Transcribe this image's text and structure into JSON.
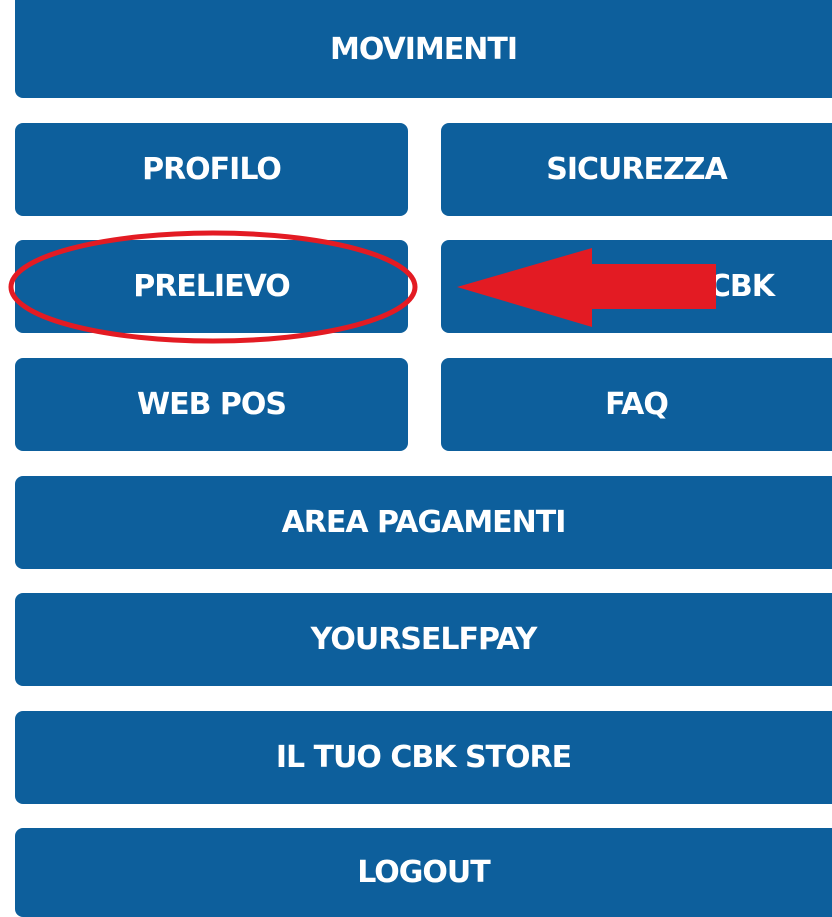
{
  "menu": {
    "movimenti_label": "MOVIMENTI",
    "profilo_label": "PROFILO",
    "sicurezza_label": "SICUREZZA",
    "prelievo_label": "PRELIEVO",
    "cbk_label": "CBK",
    "web_pos_label": "WEB POS",
    "faq_label": "FAQ",
    "area_pagamenti_label": "AREA PAGAMENTI",
    "yourselfpay_label": "YOURSELFPAY",
    "store_label": "IL TUO CBK STORE",
    "logout_label": "LOGOUT"
  },
  "annotations": {
    "highlight_color": "#e31b23",
    "button_color": "#0d5f9c"
  }
}
